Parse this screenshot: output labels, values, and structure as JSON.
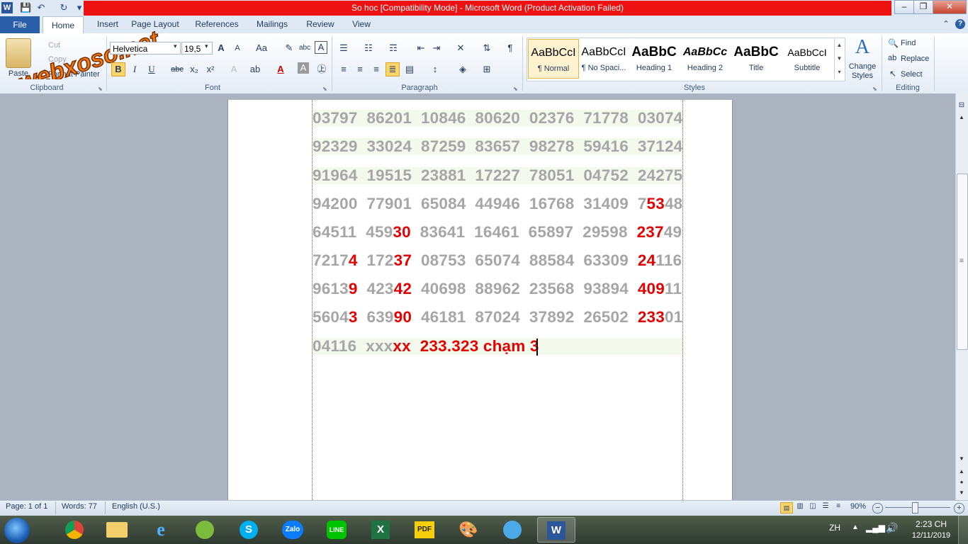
{
  "window": {
    "title": "So hoc [Compatibility Mode]  -  Microsoft Word (Product Activation Failed)",
    "app_icon": "W"
  },
  "quick_access": {
    "save_icon": "💾",
    "undo_icon": "↶",
    "redo_icon": "↻",
    "customize_icon": "▾"
  },
  "window_controls": {
    "minimize": "–",
    "restore": "❐",
    "close": "✕"
  },
  "tabs": [
    "File",
    "Home",
    "Insert",
    "Page Layout",
    "References",
    "Mailings",
    "Review",
    "View"
  ],
  "watermark_text": "webxoso.net",
  "clipboard": {
    "paste_label": "Paste",
    "cut_label": "Cut",
    "copy_label": "Copy",
    "format_painter_label": "Format Painter",
    "group_label": "Clipboard"
  },
  "font": {
    "family_value": "Helvetica",
    "size_value": "19,5",
    "group_label": "Font",
    "bold": "B",
    "italic": "I",
    "underline": "U",
    "strike": "abc",
    "sub": "x₂",
    "sup": "x²",
    "grow": "A",
    "shrink": "A",
    "change_case": "Aa",
    "clear": "A"
  },
  "paragraph": {
    "group_label": "Paragraph",
    "pilcrow": "¶"
  },
  "styles": {
    "group_label": "Styles",
    "items": [
      {
        "sample": "AaBbCcI",
        "name": "¶ Normal"
      },
      {
        "sample": "AaBbCcI",
        "name": "¶ No Spaci..."
      },
      {
        "sample": "AaBbC",
        "name": "Heading 1"
      },
      {
        "sample": "AaBbCc",
        "name": "Heading 2"
      },
      {
        "sample": "AaBbC",
        "name": "Title"
      },
      {
        "sample": "AaBbCcI",
        "name": "Subtitle"
      }
    ],
    "change_styles_label": "Change Styles"
  },
  "editing": {
    "group_label": "Editing",
    "find_label": "Find",
    "replace_label": "Replace",
    "select_label": "Select"
  },
  "document": {
    "lines": [
      [
        {
          "t": "03797  86201  10846  80620  02376  71778  03074"
        }
      ],
      [
        {
          "t": "92329  33024  87259  83657  98278  59416  37124"
        }
      ],
      [
        {
          "t": "91964  19515  23881  17227  78051  04752  24275"
        }
      ],
      [
        {
          "t": "94200  77901  65084  44946  16768  31409  7"
        },
        {
          "t": "53",
          "h": 1
        },
        {
          "t": "48"
        }
      ],
      [
        {
          "t": "64511  459"
        },
        {
          "t": "30",
          "h": 1
        },
        {
          "t": "  83641  16461  65897  29598  "
        },
        {
          "t": "237",
          "h": 1
        },
        {
          "t": "49"
        }
      ],
      [
        {
          "t": "7217"
        },
        {
          "t": "4",
          "h": 1
        },
        {
          "t": "  172"
        },
        {
          "t": "37",
          "h": 1
        },
        {
          "t": "  08753  65074  88584  63309  "
        },
        {
          "t": "24",
          "h": 1
        },
        {
          "t": "116"
        }
      ],
      [
        {
          "t": "9613"
        },
        {
          "t": "9",
          "h": 1
        },
        {
          "t": "  423"
        },
        {
          "t": "42",
          "h": 1
        },
        {
          "t": "  40698  88962  23568  93894  "
        },
        {
          "t": "409",
          "h": 1
        },
        {
          "t": "11"
        }
      ],
      [
        {
          "t": "5604"
        },
        {
          "t": "3",
          "h": 1
        },
        {
          "t": "  639"
        },
        {
          "t": "90",
          "h": 1
        },
        {
          "t": "  46181  87024  37892  26502  "
        },
        {
          "t": "233",
          "h": 1
        },
        {
          "t": "01"
        }
      ],
      [
        {
          "t": "04116  xxx"
        },
        {
          "t": "xx  233.323 chạm 3",
          "h": 1
        }
      ]
    ]
  },
  "status": {
    "page": "Page: 1 of 1",
    "words": "Words: 77",
    "language": "English (U.S.)",
    "zoom": "90%"
  },
  "taskbar": {
    "language": "ZH",
    "time": "2:23 CH",
    "date": "12/11/2019",
    "apps": [
      "Chrome",
      "Explorer",
      "Internet Explorer",
      "CocCoc",
      "Skype",
      "Zalo",
      "LINE",
      "Excel",
      "PDF",
      "Paint",
      "Bird",
      "Word"
    ]
  },
  "colors": {
    "accent": "#2a5ea8",
    "title_bg": "#ee1111",
    "highlight": "#e60000",
    "digits": "#a6a6a6"
  }
}
